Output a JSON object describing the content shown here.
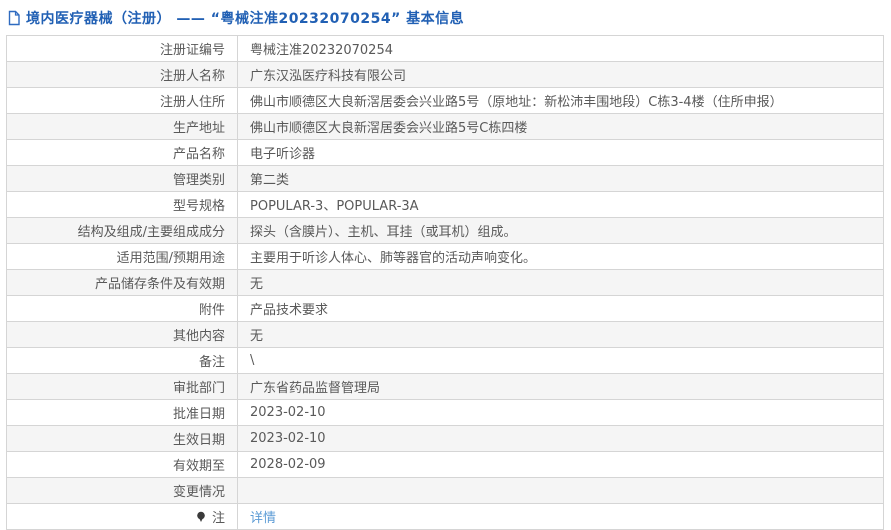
{
  "page": {
    "title": "境内医疗器械（注册） —— “粤械注准20232070254” 基本信息",
    "title_icon": "document-icon"
  },
  "colors": {
    "title_blue": "#2160b4",
    "link_blue": "#5b9bd5",
    "body_text": "#595959",
    "border": "#d5d5d5",
    "row_alt_bg": "#f5f5f5"
  },
  "table": {
    "rows": [
      {
        "label": "注册证编号",
        "value": "粤械注准20232070254"
      },
      {
        "label": "注册人名称",
        "value": "广东汉泓医疗科技有限公司"
      },
      {
        "label": "注册人住所",
        "value": "佛山市顺德区大良新滘居委会兴业路5号（原地址：新松沛丰围地段）C栋3-4楼（住所申报）"
      },
      {
        "label": "生产地址",
        "value": "佛山市顺德区大良新滘居委会兴业路5号C栋四楼"
      },
      {
        "label": "产品名称",
        "value": "电子听诊器"
      },
      {
        "label": "管理类别",
        "value": "第二类"
      },
      {
        "label": "型号规格",
        "value": "POPULAR-3、POPULAR-3A"
      },
      {
        "label": "结构及组成/主要组成成分",
        "value": "探头（含膜片）、主机、耳挂（或耳机）组成。"
      },
      {
        "label": "适用范围/预期用途",
        "value": "主要用于听诊人体心、肺等器官的活动声响变化。"
      },
      {
        "label": "产品储存条件及有效期",
        "value": "无"
      },
      {
        "label": "附件",
        "value": "产品技术要求"
      },
      {
        "label": "其他内容",
        "value": "无"
      },
      {
        "label": "备注",
        "value": "\\"
      },
      {
        "label": "审批部门",
        "value": "广东省药品监督管理局"
      },
      {
        "label": "批准日期",
        "value": "2023-02-10"
      },
      {
        "label": "生效日期",
        "value": "2023-02-10"
      },
      {
        "label": "有效期至",
        "value": "2028-02-09"
      },
      {
        "label": "变更情况",
        "value": ""
      },
      {
        "label": "注",
        "value": "详情",
        "is_link": true,
        "label_icon": "note-icon"
      }
    ]
  }
}
